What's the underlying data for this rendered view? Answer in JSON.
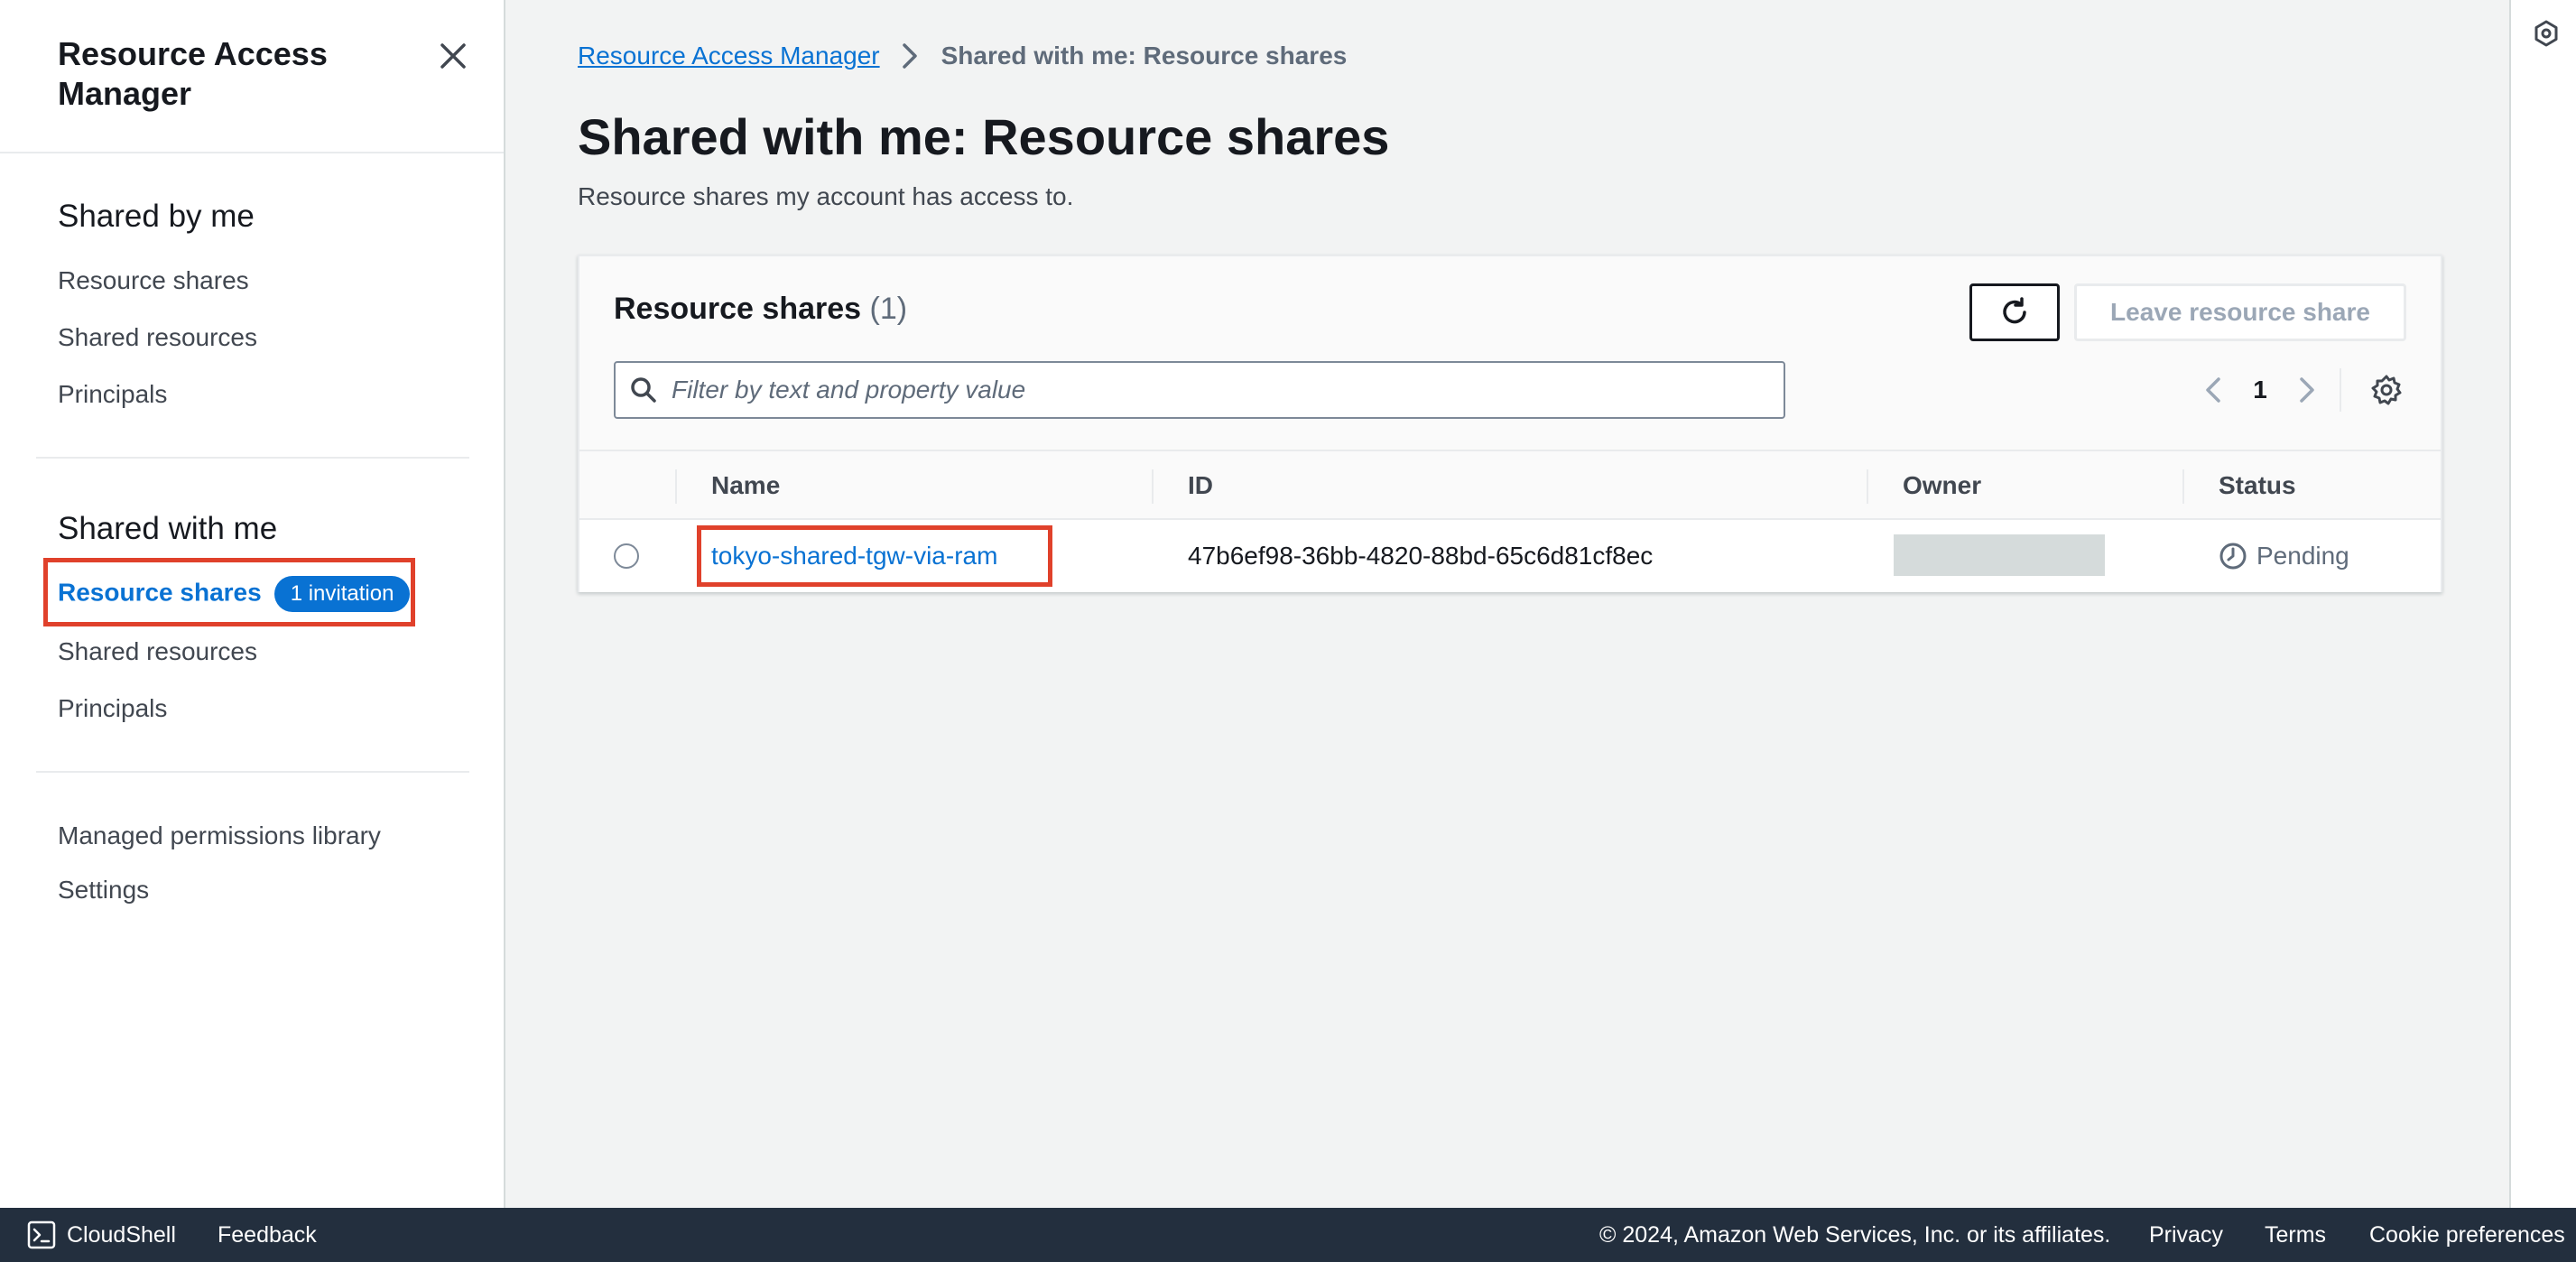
{
  "sidebar": {
    "title": "Resource Access Manager",
    "shared_by_me": {
      "heading": "Shared by me",
      "items": [
        "Resource shares",
        "Shared resources",
        "Principals"
      ]
    },
    "shared_with_me": {
      "heading": "Shared with me",
      "active_item": "Resource shares",
      "badge": "1 invitation",
      "items": [
        "Shared resources",
        "Principals"
      ]
    },
    "bottom_items": [
      "Managed permissions library",
      "Settings"
    ]
  },
  "breadcrumb": {
    "parent": "Resource Access Manager",
    "current": "Shared with me: Resource shares"
  },
  "page": {
    "title": "Shared with me: Resource shares",
    "description": "Resource shares my account has access to."
  },
  "table": {
    "title": "Resource shares",
    "count": "(1)",
    "leave_button": "Leave resource share",
    "filter_placeholder": "Filter by text and property value",
    "current_page": "1",
    "columns": [
      "Name",
      "ID",
      "Owner",
      "Status"
    ],
    "rows": [
      {
        "name": "tokyo-shared-tgw-via-ram",
        "id": "47b6ef98-36bb-4820-88bd-65c6d81cf8ec",
        "owner": "",
        "status": "Pending"
      }
    ]
  },
  "footer": {
    "cloudshell": "CloudShell",
    "feedback": "Feedback",
    "copyright": "© 2024, Amazon Web Services, Inc. or its affiliates.",
    "privacy": "Privacy",
    "terms": "Terms",
    "cookie": "Cookie preferences"
  },
  "colors": {
    "link": "#0972d3",
    "highlight": "#e0412b",
    "footer_bg": "#232f3e"
  }
}
